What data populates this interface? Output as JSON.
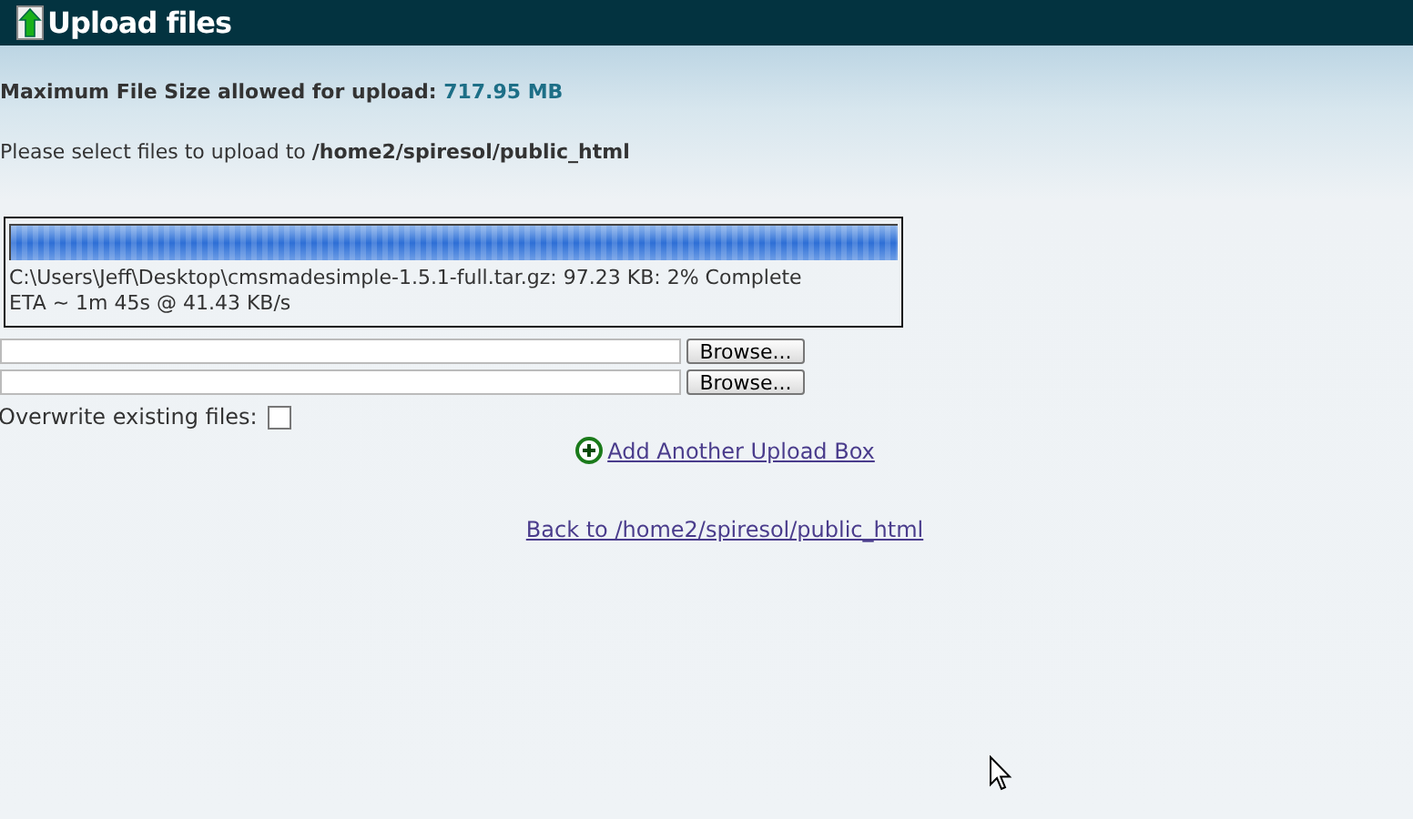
{
  "window": {
    "title": "Upload files"
  },
  "max_size": {
    "label": "Maximum File Size allowed for upload:",
    "value": "717.95 MB"
  },
  "destination": {
    "label": "Please select files to upload to",
    "path": "/home2/spiresol/public_html"
  },
  "progress": {
    "level": 1,
    "file_line": "C:\\Users\\Jeff\\Desktop\\cmsmadesimple-1.5.1-full.tar.gz: 97.23 KB: 2% Complete",
    "eta_line": "ETA ~ 1m 45s @ 41.43 KB/s"
  },
  "upload_boxes": [
    {
      "button": "Browse..."
    },
    {
      "button": "Browse..."
    }
  ],
  "overwrite": {
    "label": "Overwrite existing files:",
    "checked": false
  },
  "add_link": "Add Another Upload Box",
  "back_link": "Back to /home2/spiresol/public_html"
}
